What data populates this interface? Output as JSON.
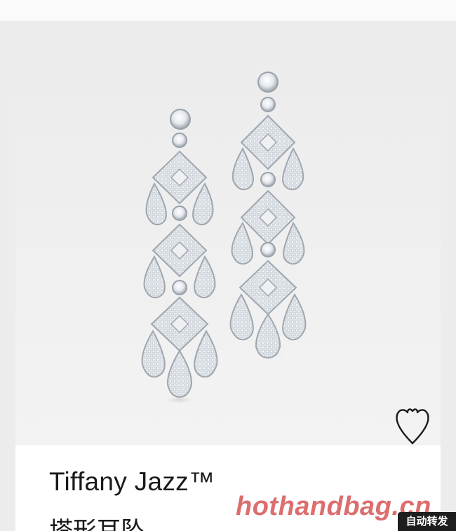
{
  "product": {
    "title": "Tiffany Jazz™",
    "subtitle": "塔形耳坠",
    "wishlist_icon": "heart-icon"
  },
  "overlay": {
    "watermark": "hothandbag.cn",
    "auto_forward_label": "自动转发"
  },
  "colors": {
    "metal": "#b9bec4",
    "diamond_fill": "#f4f7fa",
    "diamond_shadow": "#8c939b",
    "watermark": "#d44e4e",
    "badge_bg": "#1e1e1e"
  }
}
